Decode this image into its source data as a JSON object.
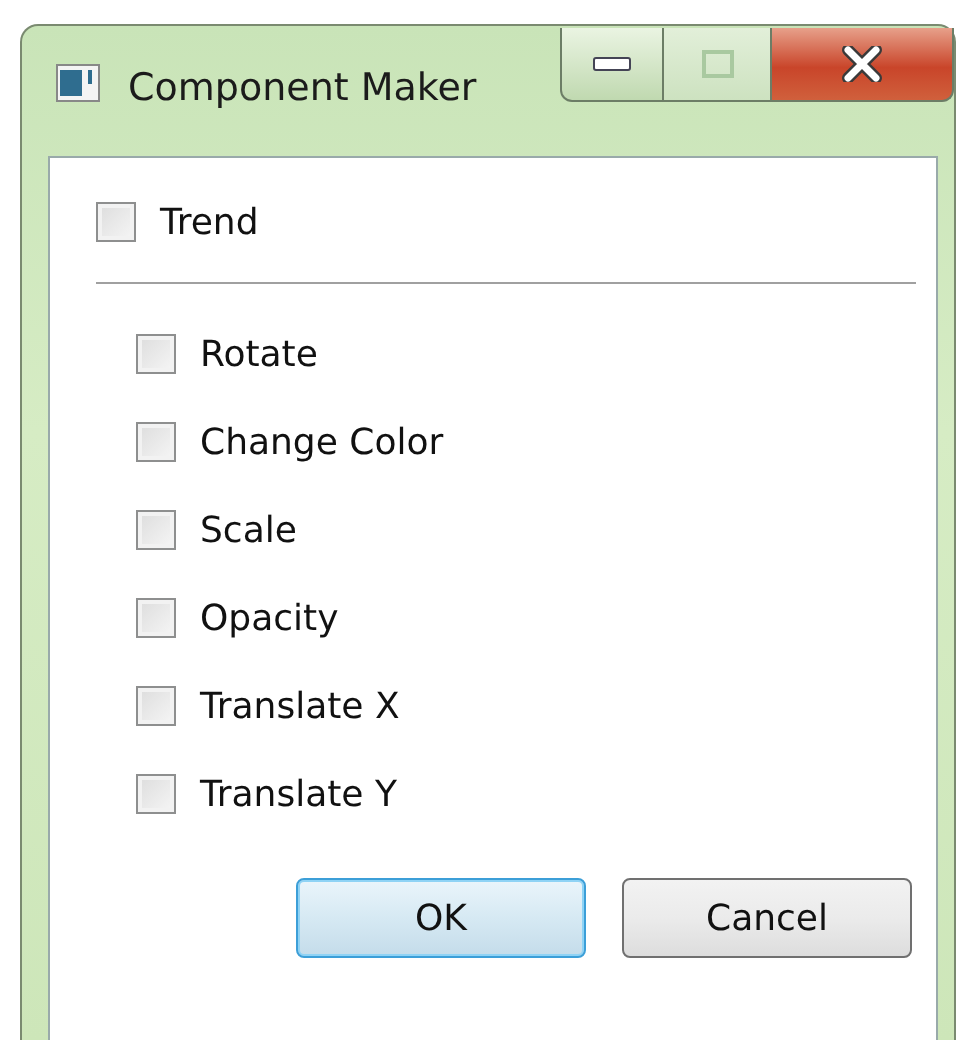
{
  "window": {
    "title": "Component Maker",
    "maximize_disabled": true
  },
  "master": {
    "label": "Trend",
    "checked": false
  },
  "options": [
    {
      "label": "Rotate",
      "checked": false
    },
    {
      "label": "Change Color",
      "checked": false
    },
    {
      "label": "Scale",
      "checked": false
    },
    {
      "label": "Opacity",
      "checked": false
    },
    {
      "label": "Translate X",
      "checked": false
    },
    {
      "label": "Translate Y",
      "checked": false
    }
  ],
  "buttons": [
    {
      "label": "OK",
      "default": true
    },
    {
      "label": "Cancel",
      "default": false
    }
  ]
}
